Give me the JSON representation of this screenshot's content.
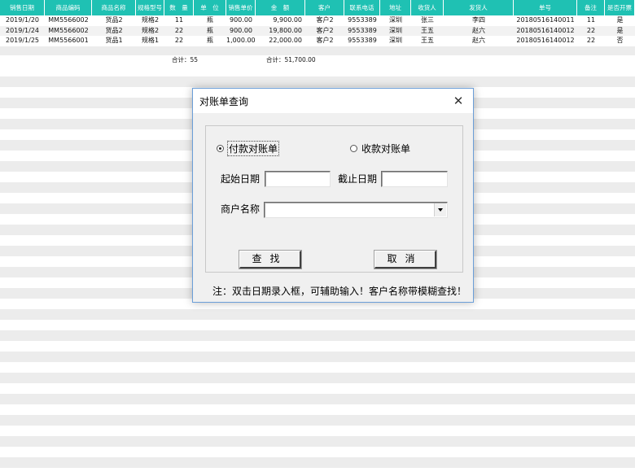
{
  "sheet": {
    "columns": [
      {
        "label": "销售日期",
        "w": 55
      },
      {
        "label": "商品编码",
        "w": 58
      },
      {
        "label": "商品名称",
        "w": 54
      },
      {
        "label": "规格型号",
        "w": 35
      },
      {
        "label": "数　量",
        "w": 36
      },
      {
        "label": "单　位",
        "w": 40
      },
      {
        "label": "销售单价",
        "w": 36
      },
      {
        "label": "金　额",
        "w": 61
      },
      {
        "label": "客户",
        "w": 48
      },
      {
        "label": "联系电话",
        "w": 44
      },
      {
        "label": "地址",
        "w": 38
      },
      {
        "label": "收货人",
        "w": 40
      },
      {
        "label": "发货人",
        "w": 86
      },
      {
        "label": "单号",
        "w": 78
      },
      {
        "label": "备注",
        "w": 34
      },
      {
        "label": "是否开票",
        "w": 37
      }
    ],
    "rows": [
      [
        "2019/1/20",
        "MM5566002",
        "货品2",
        "规格2",
        "11",
        "瓶",
        "900.00",
        "9,900.00",
        "客户2",
        "9553389",
        "深圳",
        "张三",
        "李四",
        "20180516140011",
        "11",
        "是"
      ],
      [
        "2019/1/24",
        "MM5566002",
        "货品2",
        "规格2",
        "22",
        "瓶",
        "900.00",
        "19,800.00",
        "客户2",
        "9553389",
        "深圳",
        "王五",
        "赵六",
        "20180516140012",
        "22",
        "是"
      ],
      [
        "2019/1/25",
        "MM5566001",
        "货品1",
        "规格1",
        "22",
        "瓶",
        "1,000.00",
        "22,000.00",
        "客户2",
        "9553389",
        "深圳",
        "王五",
        "赵六",
        "20180516140012",
        "22",
        "否"
      ]
    ],
    "totals": {
      "qty": "合计：55",
      "amount": "合计：51,700.00"
    }
  },
  "dialog": {
    "title": "对账单查询",
    "radio_pay": "付款对账单",
    "radio_receive": "收款对账单",
    "selected": "radio_pay",
    "start_date_label": "起始日期",
    "end_date_label": "截止日期",
    "start_date_value": "",
    "end_date_value": "",
    "merchant_label": "商户名称",
    "merchant_value": "",
    "find_button": "查找",
    "cancel_button": "取消",
    "note": "注：双击日期录入框，可辅助输入！客户名称带模糊查找！"
  }
}
